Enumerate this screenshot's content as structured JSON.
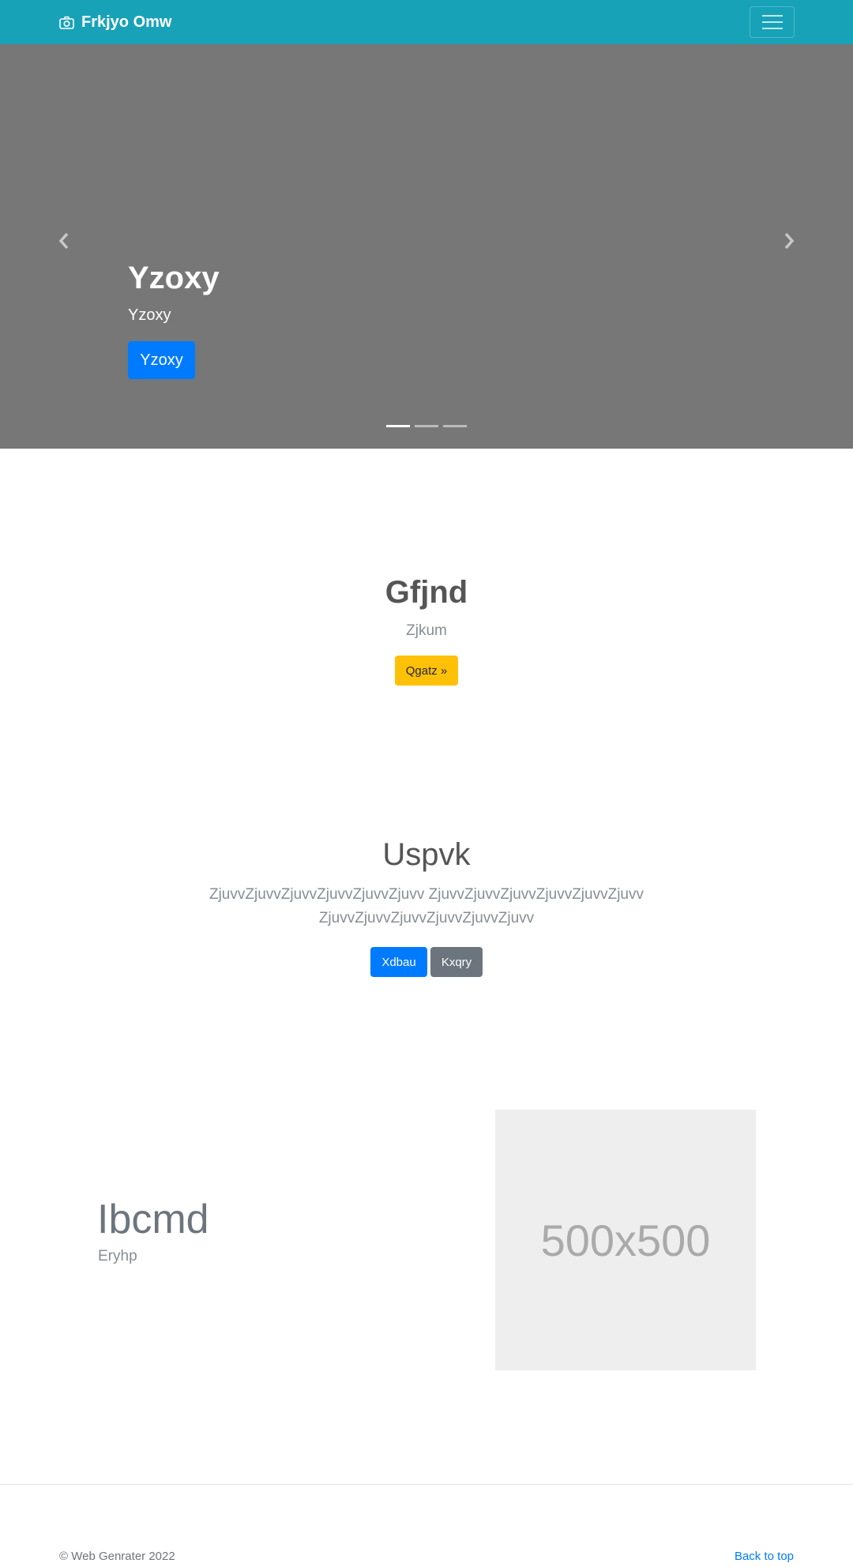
{
  "navbar": {
    "brand": "Frkjyo Omw",
    "brand_icon": "camera-icon",
    "toggler_icon": "hamburger-icon",
    "background": "#17a2b8"
  },
  "carousel": {
    "title": "Yzoxy",
    "subtitle": "Yzoxy",
    "button_label": "Yzoxy",
    "prev_icon": "chevron-left-icon",
    "next_icon": "chevron-right-icon",
    "slide_count": 3,
    "active_slide": 0,
    "background": "#777777"
  },
  "section_one": {
    "title": "Gfjnd",
    "subtitle": "Zjkum",
    "button_label": "Qgatz »"
  },
  "section_two": {
    "title": "Uspvk",
    "text": "ZjuvvZjuvvZjuvvZjuvvZjuvvZjuvv ZjuvvZjuvvZjuvvZjuvvZjuvvZjuvv ZjuvvZjuvvZjuvvZjuvvZjuvvZjuvv",
    "primary_button": "Xdbau",
    "secondary_button": "Kxqry"
  },
  "section_three": {
    "title": "Ibcmd",
    "subtitle": "Eryhp",
    "image_label": "500x500"
  },
  "footer": {
    "copyright": "© Web Genrater 2022",
    "back_to_top": "Back to top"
  },
  "colors": {
    "primary": "#007bff",
    "secondary": "#6c757d",
    "warning": "#ffc107"
  }
}
